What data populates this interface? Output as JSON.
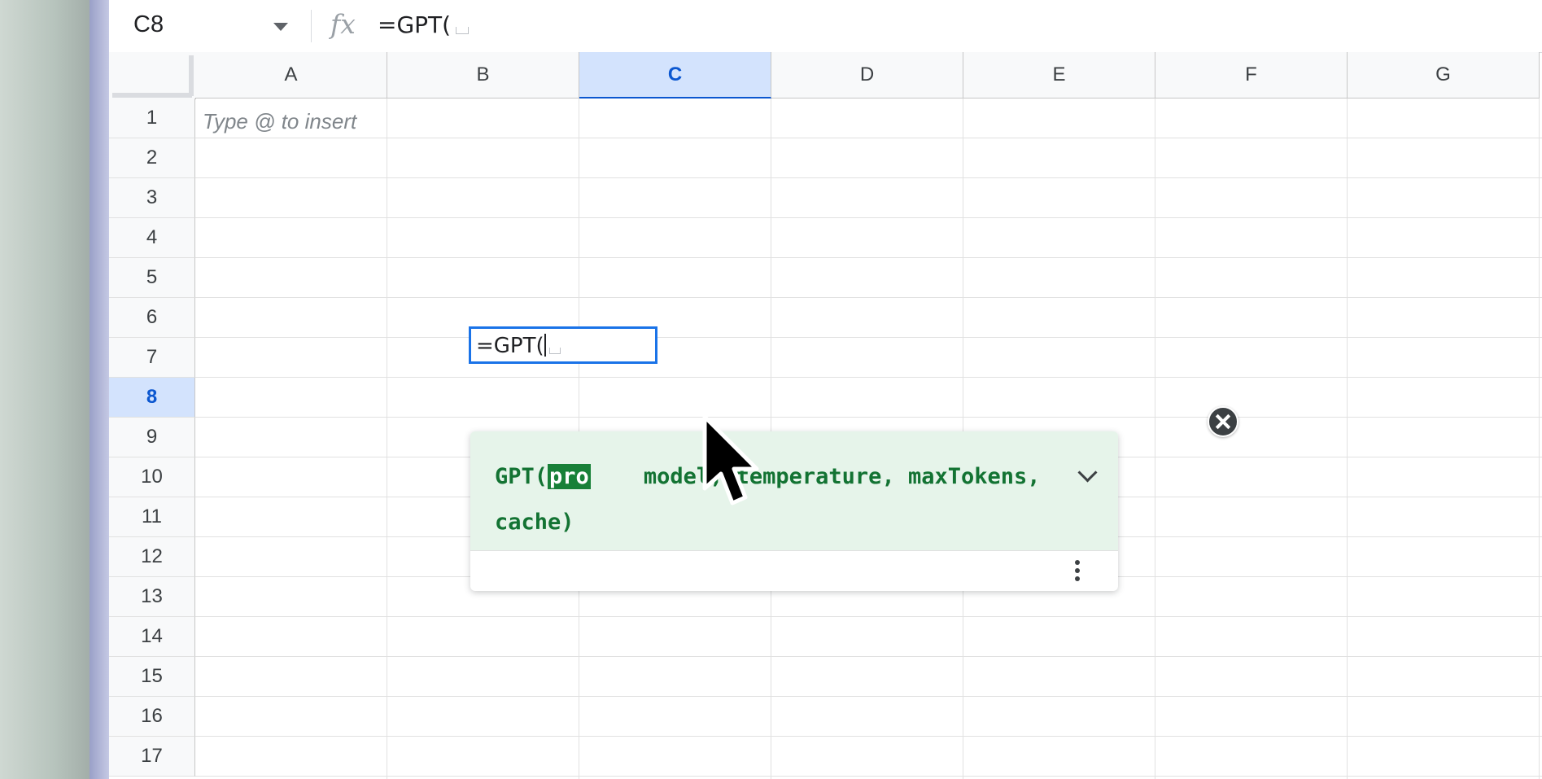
{
  "formula_bar": {
    "name_box": "C8",
    "fx_label": "fx",
    "formula": "=GPT("
  },
  "columns": [
    "A",
    "B",
    "C",
    "D",
    "E",
    "F",
    "G"
  ],
  "active_column": "C",
  "rows": [
    "1",
    "2",
    "3",
    "4",
    "5",
    "6",
    "7",
    "8",
    "9",
    "10",
    "11",
    "12",
    "13",
    "14",
    "15",
    "16",
    "17"
  ],
  "active_row": "8",
  "cell_a1_hint": "Type @ to insert",
  "editor": {
    "text": "=GPT("
  },
  "autocomplete": {
    "fn_open": "GPT(",
    "highlighted_param": "pro",
    "rest_line1": "model, temperature, maxTokens,",
    "line2": "cache)"
  },
  "icons": {
    "dropdown": "chevron-down-icon",
    "formula": "fx-icon",
    "close": "close-icon",
    "expand": "chevron-down-icon",
    "more": "kebab-menu-icon",
    "pointer": "mouse-cursor-icon"
  },
  "colors": {
    "selection_blue": "#1a73e8",
    "header_active_bg": "#d3e3fd",
    "popup_green_bg": "#e6f4ea",
    "signature_green": "#137333",
    "highlight_green": "#188038"
  }
}
